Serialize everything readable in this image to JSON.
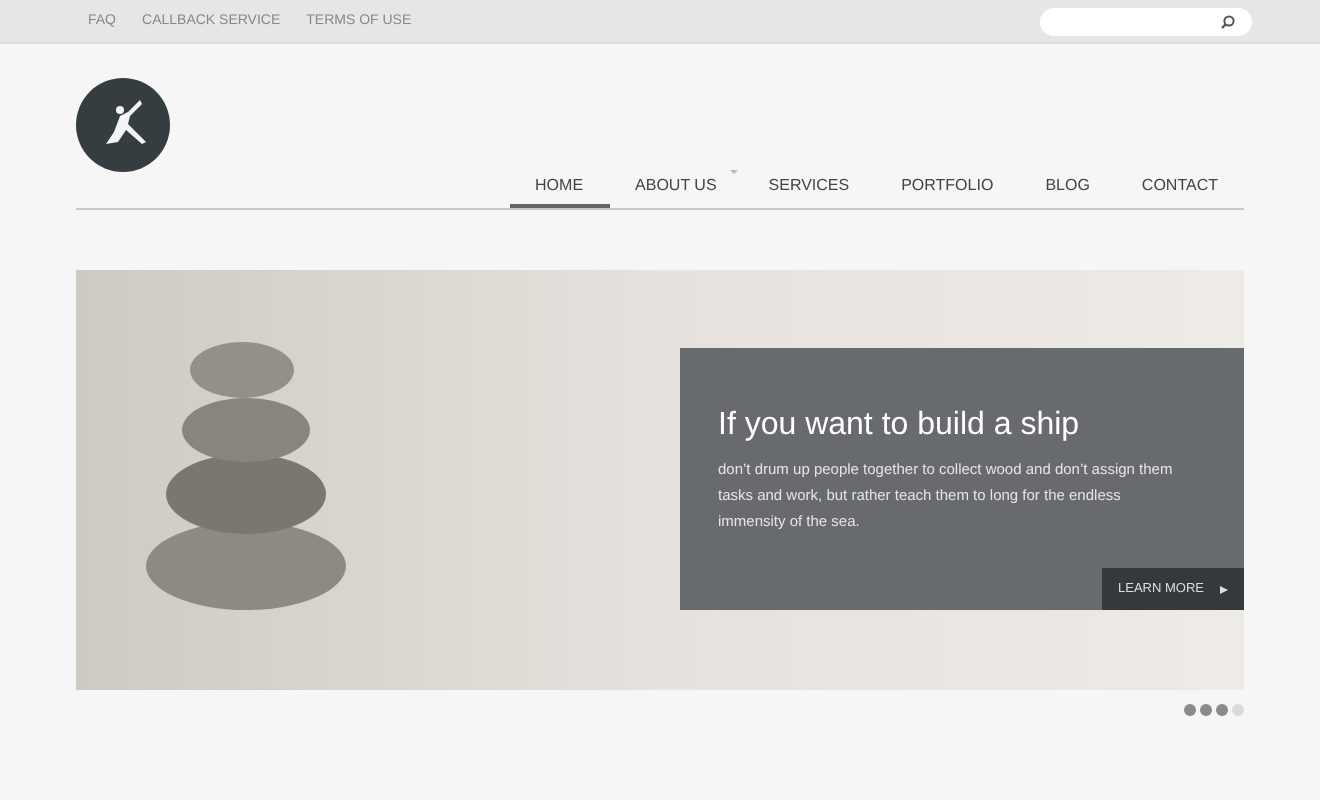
{
  "top_links": [
    "FAQ",
    "CALLBACK SERVICE",
    "TERMS OF USE"
  ],
  "nav": [
    {
      "label": "HOME",
      "selected": true,
      "dropdown": false
    },
    {
      "label": "ABOUT US",
      "selected": false,
      "dropdown": true
    },
    {
      "label": "SERVICES",
      "selected": false,
      "dropdown": false
    },
    {
      "label": "PORTFOLIO",
      "selected": false,
      "dropdown": false
    },
    {
      "label": "BLOG",
      "selected": false,
      "dropdown": false
    },
    {
      "label": "CONTACT",
      "selected": false,
      "dropdown": false
    }
  ],
  "hero": {
    "title": "If you want to build a ship",
    "text": "don’t drum up people together to collect wood and don’t assign them tasks and work, but rather teach them to long for the endless immensity of the sea.",
    "button": "LEARN MORE"
  },
  "slider_dots": [
    {
      "selected": false
    },
    {
      "selected": false
    },
    {
      "selected": false
    },
    {
      "selected": true
    }
  ]
}
